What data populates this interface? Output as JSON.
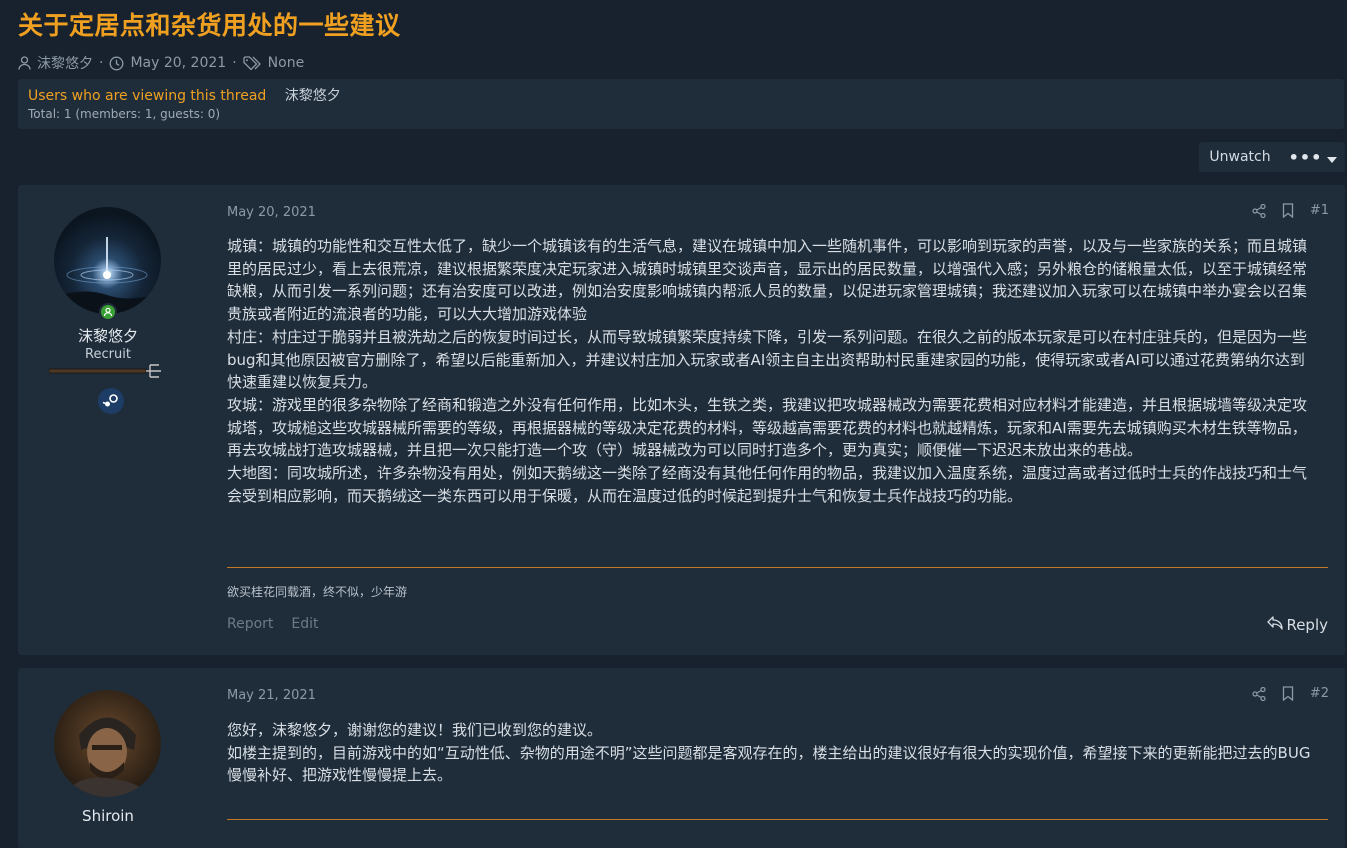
{
  "thread": {
    "title": "关于定居点和杂货用处的一些建议",
    "author": "沫黎悠夕",
    "date": "May 20, 2021",
    "prefix": "None",
    "sep": "·"
  },
  "viewing": {
    "label": "Users who are viewing this thread",
    "users": "沫黎悠夕",
    "total": "Total: 1 (members: 1, guests: 0)"
  },
  "toolbar": {
    "unwatch": "Unwatch",
    "more": "•••"
  },
  "posts": [
    {
      "author": "沫黎悠夕",
      "user_title": "Recruit",
      "date": "May 20, 2021",
      "number": "#1",
      "body": [
        "城镇：城镇的功能性和交互性太低了，缺少一个城镇该有的生活气息，建议在城镇中加入一些随机事件，可以影响到玩家的声誉，以及与一些家族的关系；而且城镇里的居民过少，看上去很荒凉，建议根据繁荣度决定玩家进入城镇时城镇里交谈声音，显示出的居民数量，以增强代入感；另外粮仓的储粮量太低，以至于城镇经常缺粮，从而引发一系列问题；还有治安度可以改进，例如治安度影响城镇内帮派人员的数量，以促进玩家管理城镇；我还建议加入玩家可以在城镇中举办宴会以召集贵族或者附近的流浪者的功能，可以大大增加游戏体验",
        "村庄：村庄过于脆弱并且被洗劫之后的恢复时间过长，从而导致城镇繁荣度持续下降，引发一系列问题。在很久之前的版本玩家是可以在村庄驻兵的，但是因为一些bug和其他原因被官方删除了，希望以后能重新加入，并建议村庄加入玩家或者AI领主自主出资帮助村民重建家园的功能，使得玩家或者AI可以通过花费第纳尔达到快速重建以恢复兵力。",
        "攻城：游戏里的很多杂物除了经商和锻造之外没有任何作用，比如木头，生铁之类，我建议把攻城器械改为需要花费相对应材料才能建造，并且根据城墙等级决定攻城塔，攻城槌这些攻城器械所需要的等级，再根据器械的等级决定花费的材料，等级越高需要花费的材料也就越精炼，玩家和AI需要先去城镇购买木材生铁等物品，再去攻城战打造攻城器械，并且把一次只能打造一个攻（守）城器械改为可以同时打造多个，更为真实；顺便催一下迟迟未放出来的巷战。",
        "大地图：同攻城所述，许多杂物没有用处，例如天鹅绒这一类除了经商没有其他任何作用的物品，我建议加入温度系统，温度过高或者过低时士兵的作战技巧和士气会受到相应影响，而天鹅绒这一类东西可以用于保暖，从而在温度过低的时候起到提升士气和恢复士兵作战技巧的功能。"
      ],
      "signature": "欲买桂花同载酒，终不似，少年游",
      "report": "Report",
      "edit": "Edit",
      "reply": "Reply"
    },
    {
      "author": "Shiroin",
      "date": "May 21, 2021",
      "number": "#2",
      "body": [
        "您好，沫黎悠夕，谢谢您的建议！我们已收到您的建议。",
        "如楼主提到的，目前游戏中的如“互动性低、杂物的用途不明”这些问题都是客观存在的，楼主给出的建议很好有很大的实现价值，希望接下来的更新能把过去的BUG慢慢补好、把游戏性慢慢提上去。"
      ]
    }
  ],
  "colors": {
    "accent": "#f0a020",
    "background": "#17222e",
    "panel": "#1f2d3b",
    "online": "#3aa036",
    "signature_rule": "#c07828"
  }
}
